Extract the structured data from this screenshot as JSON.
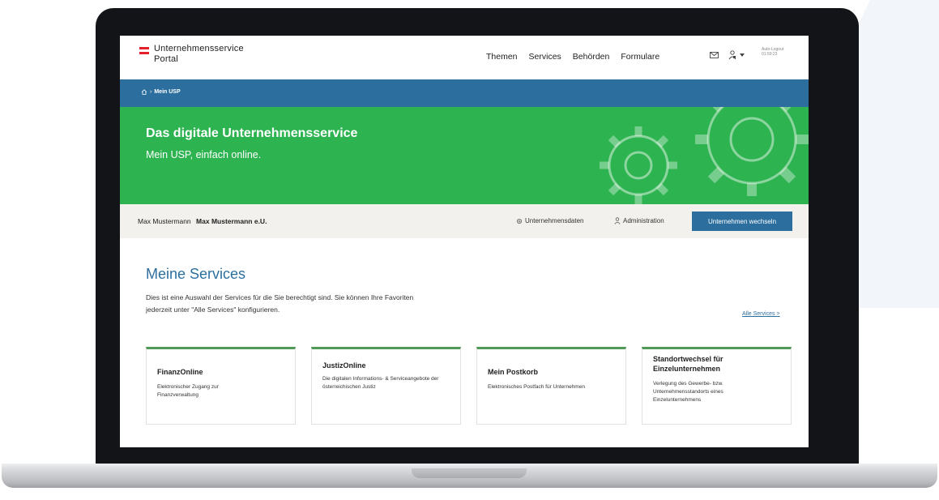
{
  "header": {
    "logo_line1": "Unternehmensservice",
    "logo_line2": "Portal",
    "nav": [
      "Themen",
      "Services",
      "Behörden",
      "Formulare"
    ],
    "autologout_label": "Auto-Logout",
    "autologout_value": "01:59:23"
  },
  "breadcrumb": {
    "current": "Mein USP"
  },
  "hero": {
    "title": "Das digitale Unternehmensservice",
    "subtitle": "Mein USP, einfach online."
  },
  "account": {
    "user": "Max Mustermann",
    "company": "Max Mustermann e.U.",
    "link_data": "Unternehmensdaten",
    "link_admin": "Administration",
    "switch_button": "Unternehmen wechseln"
  },
  "services": {
    "title": "Meine Services",
    "desc_line1": "Dies ist eine Auswahl der Services für die Sie berechtigt sind. Sie können Ihre Favoriten",
    "desc_line2": "jederzeit unter \"Alle Services\" konfigurieren.",
    "all_link": "Alle Services >",
    "cards": [
      {
        "title": "FinanzOnline",
        "desc": "Elektronischer Zugang zur Finanzverwaltung"
      },
      {
        "title": "JustizOnline",
        "desc": "Die digitalen Informations- & Serviceangebote der österreichischen Justiz"
      },
      {
        "title": "Mein Postkorb",
        "desc": "Elektronisches Postfach für Unternehmen"
      },
      {
        "title_line1": "Standortwechsel für",
        "title_line2": "Einzelunternehmen",
        "desc": "Verlegung des Gewerbe- bzw. Unternehmensstandorts eines Einzelunternehmens"
      }
    ]
  },
  "colors": {
    "brand_blue": "#2c6f9f",
    "hero_green": "#2eb351",
    "card_accent": "#4f9a55",
    "flag_red": "#e4202c"
  }
}
